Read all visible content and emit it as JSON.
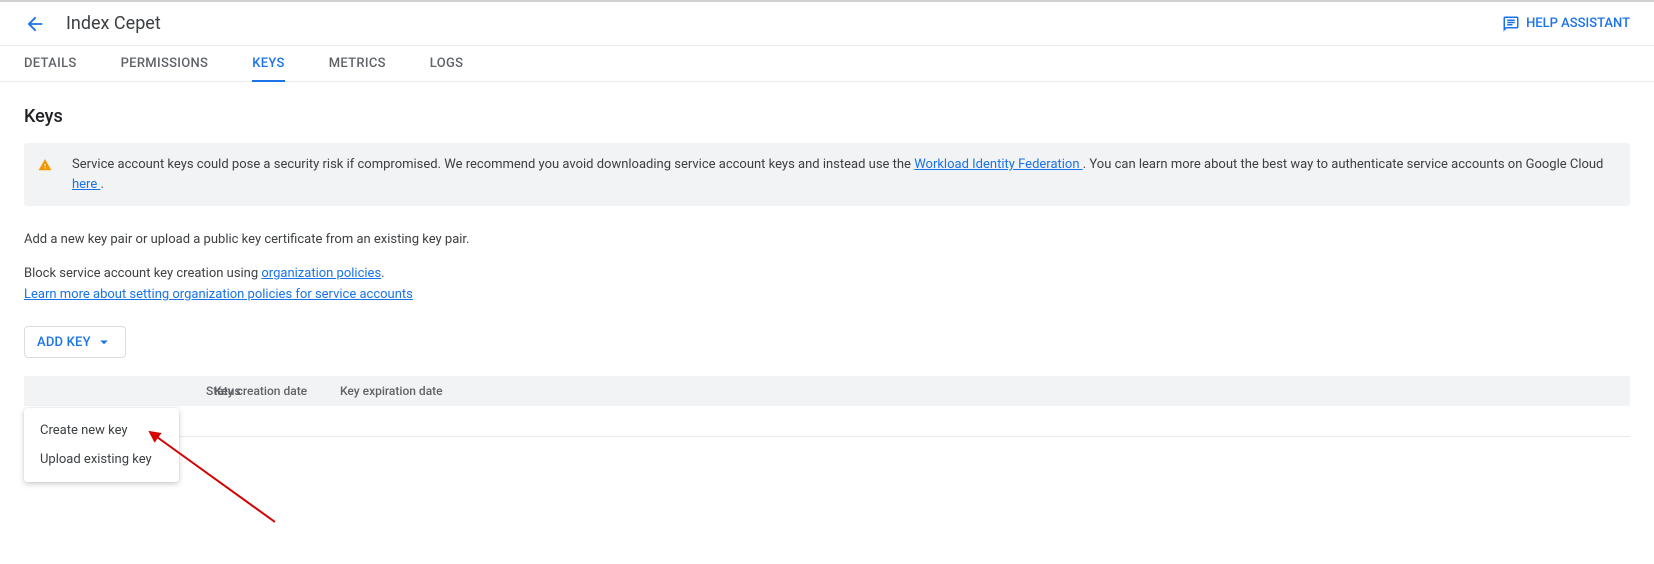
{
  "header": {
    "title": "Index Cepet",
    "help_label": "HELP ASSISTANT"
  },
  "tabs": [
    {
      "label": "DETAILS",
      "active": false
    },
    {
      "label": "PERMISSIONS",
      "active": false
    },
    {
      "label": "KEYS",
      "active": true
    },
    {
      "label": "METRICS",
      "active": false
    },
    {
      "label": "LOGS",
      "active": false
    }
  ],
  "keys": {
    "heading": "Keys",
    "warning": {
      "text1": "Service account keys could pose a security risk if compromised. We recommend you avoid downloading service account keys and instead use the ",
      "link1": "Workload Identity Federation ",
      "text2": ". You can learn more about the best way to authenticate service accounts on Google Cloud ",
      "link2": "here ",
      "text3": "."
    },
    "desc": "Add a new key pair or upload a public key certificate from an existing key pair.",
    "block_text": "Block service account key creation using ",
    "block_link": "organization policies",
    "block_suffix": ".",
    "learn_more": "Learn more about setting organization policies for service accounts",
    "add_key_label": "ADD KEY",
    "dropdown": {
      "create": "Create new key",
      "upload": "Upload existing key"
    },
    "table_headers": {
      "status": "Status",
      "created": "Key creation date",
      "expires": "Key expiration date"
    }
  }
}
